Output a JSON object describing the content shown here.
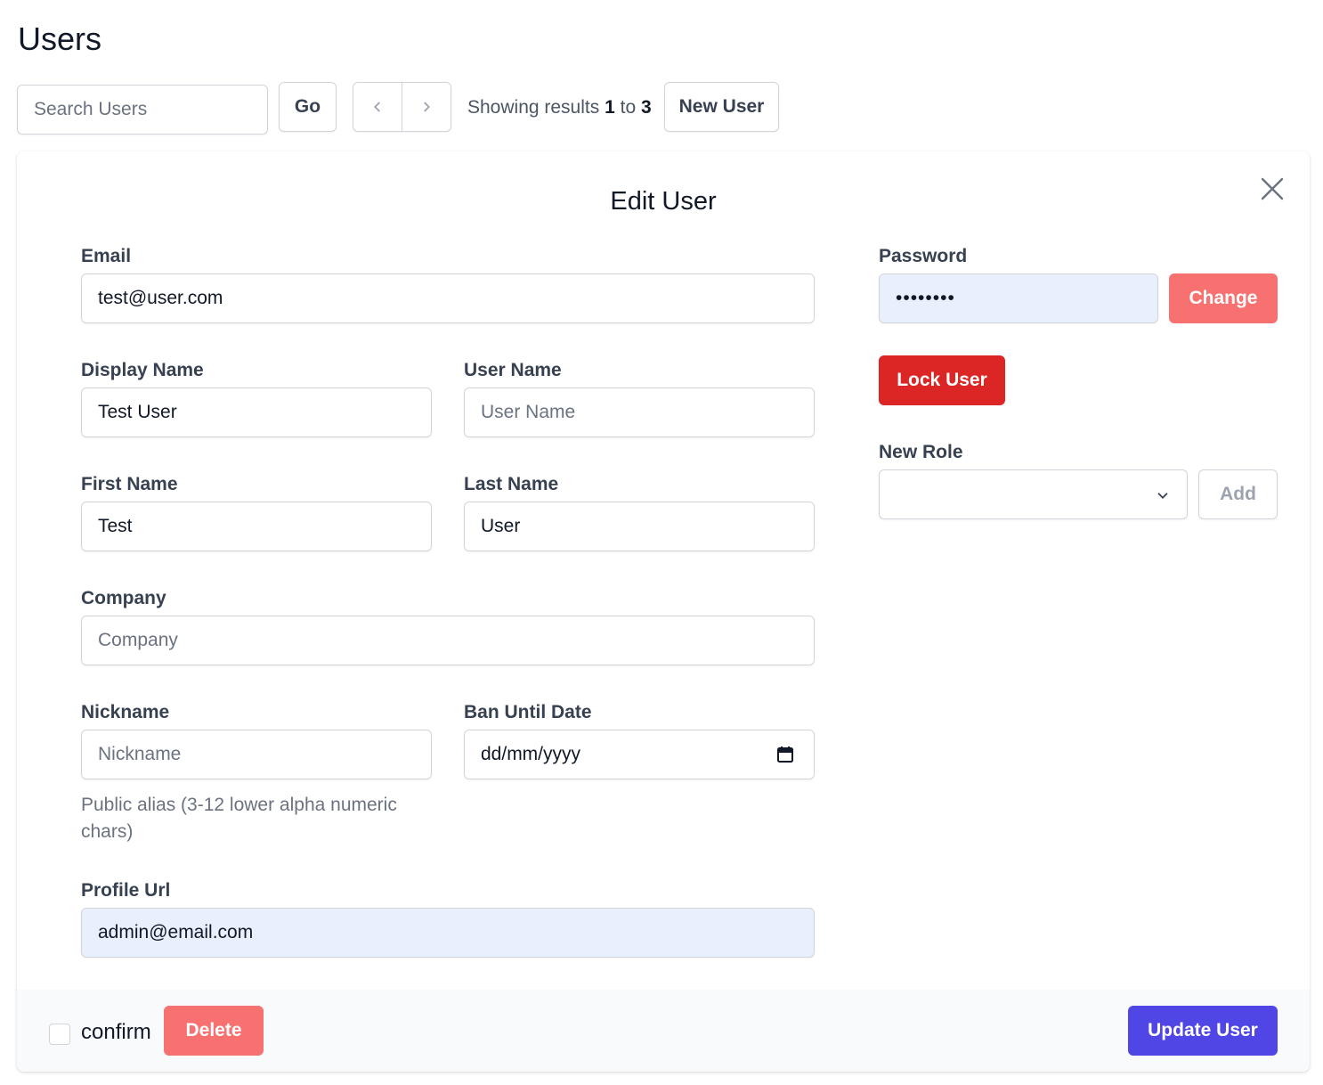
{
  "page": {
    "title": "Users"
  },
  "toolbar": {
    "search_placeholder": "Search Users",
    "go_label": "Go",
    "results_prefix": "Showing results",
    "results_from": "1",
    "results_to_word": "to",
    "results_to": "3",
    "new_user_label": "New User"
  },
  "modal": {
    "title": "Edit User",
    "fields": {
      "email": {
        "label": "Email",
        "value": "test@user.com"
      },
      "display_name": {
        "label": "Display Name",
        "value": "Test User"
      },
      "user_name": {
        "label": "User Name",
        "placeholder": "User Name",
        "value": ""
      },
      "first_name": {
        "label": "First Name",
        "value": "Test"
      },
      "last_name": {
        "label": "Last Name",
        "value": "User"
      },
      "company": {
        "label": "Company",
        "placeholder": "Company",
        "value": ""
      },
      "nickname": {
        "label": "Nickname",
        "placeholder": "Nickname",
        "value": "",
        "help": "Public alias (3-12 lower alpha numeric chars)"
      },
      "ban_until": {
        "label": "Ban Until Date",
        "placeholder": "dd/mm/yyyy"
      },
      "profile_url": {
        "label": "Profile Url",
        "value": "admin@email.com"
      },
      "password": {
        "label": "Password",
        "value": "••••••••"
      },
      "new_role": {
        "label": "New Role",
        "selected": ""
      }
    },
    "buttons": {
      "change": "Change",
      "lock_user": "Lock User",
      "add": "Add",
      "delete": "Delete",
      "update_user": "Update User"
    },
    "footer": {
      "confirm_label": "confirm"
    }
  },
  "colors": {
    "primary": "#4f46e5",
    "danger": "#dc2626",
    "danger_light": "#f87171",
    "autofill": "#e8f0fe"
  },
  "icons": {
    "close": "close-icon",
    "prev": "chevron-left-icon",
    "next": "chevron-right-icon",
    "select": "chevron-down-icon",
    "calendar": "calendar-icon"
  }
}
